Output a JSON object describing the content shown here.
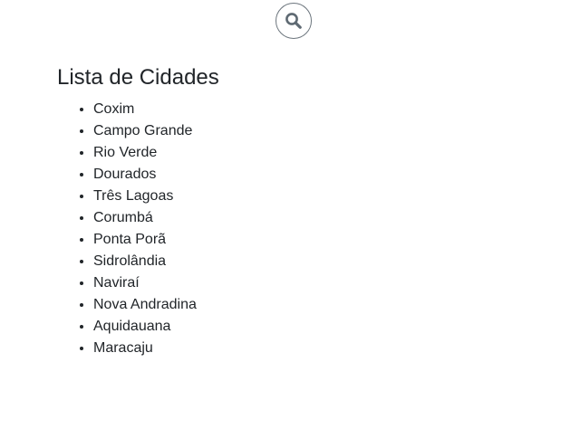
{
  "search": {
    "icon": "search-icon"
  },
  "main": {
    "title": "Lista de Cidades",
    "cities": [
      "Coxim",
      "Campo Grande",
      "Rio Verde",
      "Dourados",
      "Três Lagoas",
      "Corumbá",
      "Ponta Porã",
      "Sidrolândia",
      "Naviraí",
      "Nova Andradina",
      "Aquidauana",
      "Maracaju"
    ]
  }
}
